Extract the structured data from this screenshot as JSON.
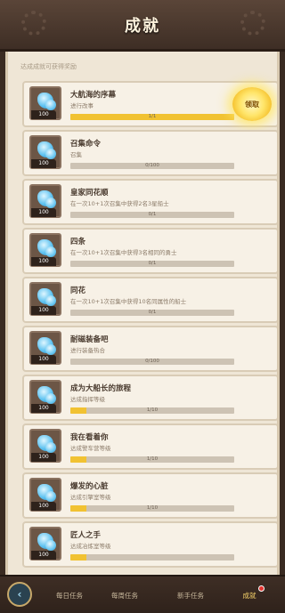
{
  "header": {
    "title": "成就"
  },
  "subtitle": "达成成就可获得奖励",
  "achievements": [
    {
      "name": "大航海的序幕",
      "desc": "进行改事",
      "progress_text": "1/1",
      "progress": 1.0,
      "qty": "100",
      "claim_label": "领取"
    },
    {
      "name": "召集命令",
      "desc": "召集",
      "progress_text": "0/100",
      "progress": 0.0,
      "qty": "100"
    },
    {
      "name": "皇家同花顺",
      "desc": "在一次10+1次召集中获得2名3星船士",
      "progress_text": "0/1",
      "progress": 0.0,
      "qty": "100"
    },
    {
      "name": "四条",
      "desc": "在一次10+1次召集中获得3名相同的勇士",
      "progress_text": "0/1",
      "progress": 0.0,
      "qty": "100"
    },
    {
      "name": "同花",
      "desc": "在一次10+1次召集中获得10名同属性的船士",
      "progress_text": "0/1",
      "progress": 0.0,
      "qty": "100"
    },
    {
      "name": "耐磁装备吧",
      "desc": "进行装备热合",
      "progress_text": "0/100",
      "progress": 0.0,
      "qty": "100"
    },
    {
      "name": "成为大船长的旅程",
      "desc": "达成指挥等级",
      "progress_text": "1/10",
      "progress": 0.1,
      "qty": "100"
    },
    {
      "name": "我在看着你",
      "desc": "达成警车营等级",
      "progress_text": "1/10",
      "progress": 0.1,
      "qty": "100"
    },
    {
      "name": "爆发的心脏",
      "desc": "达成引擎室等级",
      "progress_text": "1/10",
      "progress": 0.1,
      "qty": "100"
    },
    {
      "name": "匠人之手",
      "desc": "达成冶炼室等级",
      "progress_text": "",
      "progress": 0.1,
      "qty": "100"
    }
  ],
  "footer": {
    "back_icon": "‹",
    "tabs": [
      "每日任务",
      "每周任务",
      "新手任务",
      "成就"
    ],
    "active_tab": 3
  },
  "colors": {
    "bar_fill": "#f1c232",
    "active_tab": "#f7d36a"
  }
}
